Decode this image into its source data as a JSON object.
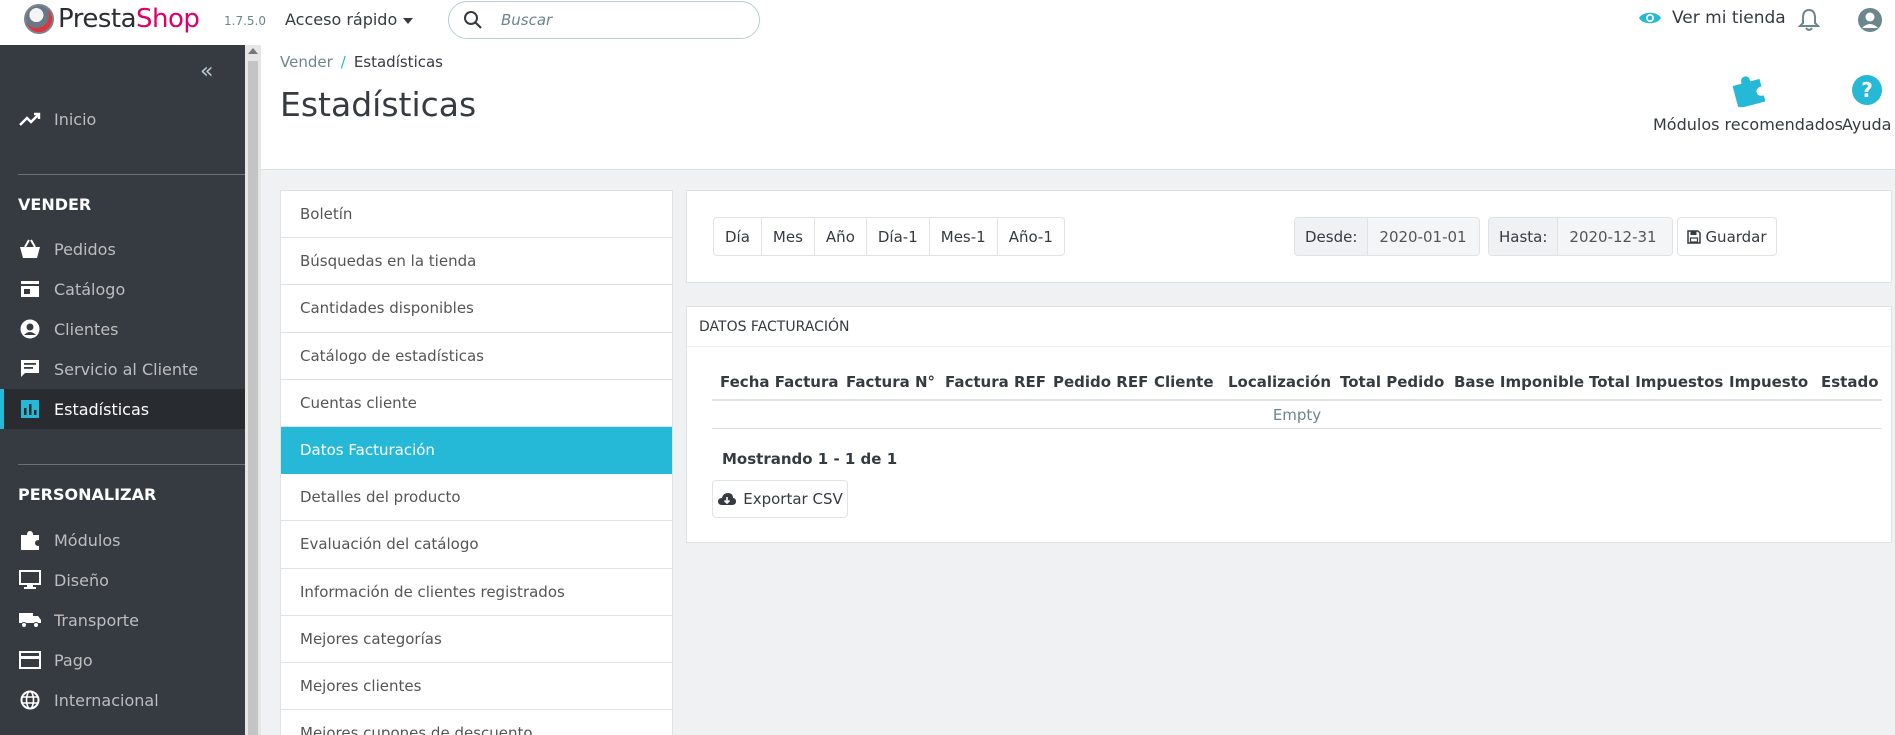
{
  "header": {
    "brand_presta": "Presta",
    "brand_shop": "Shop",
    "version": "1.7.5.0",
    "quick_access": "Acceso rápido",
    "search_placeholder": "Buscar",
    "view_store": "Ver mi tienda"
  },
  "sidebar": {
    "home": "Inicio",
    "section_sell": "VENDER",
    "sell_items": [
      "Pedidos",
      "Catálogo",
      "Clientes",
      "Servicio al Cliente",
      "Estadísticas"
    ],
    "section_customize": "PERSONALIZAR",
    "customize_items": [
      "Módulos",
      "Diseño",
      "Transporte",
      "Pago",
      "Internacional"
    ]
  },
  "breadcrumb": {
    "parent": "Vender",
    "separator": "/",
    "current": "Estadísticas"
  },
  "page_title": "Estadísticas",
  "toolbar": {
    "modules": "Módulos recomendados",
    "help": "Ayuda"
  },
  "stats_list": [
    "Boletín",
    "Búsquedas en la tienda",
    "Cantidades disponibles",
    "Catálogo de estadísticas",
    "Cuentas cliente",
    "Datos Facturación",
    "Detalles del producto",
    "Evaluación del catálogo",
    "Información de clientes registrados",
    "Mejores categorías",
    "Mejores clientes",
    "Mejores cupones de descuento"
  ],
  "stats_list_active_index": 5,
  "date_panel": {
    "period_buttons": [
      "Día",
      "Mes",
      "Año",
      "Día-1",
      "Mes-1",
      "Año-1"
    ],
    "from_label": "Desde:",
    "from_value": "2020-01-01",
    "to_label": "Hasta:",
    "to_value": "2020-12-31",
    "save_label": "Guardar"
  },
  "data_panel": {
    "heading": "DATOS FACTURACIÓN",
    "columns": [
      "Fecha Factura",
      "Factura N°",
      "Factura REF",
      "Pedido REF",
      "Cliente",
      "Localización",
      "Total Pedido",
      "Base Imponible",
      "Total Impuestos",
      "Impuesto",
      "Estado"
    ],
    "empty_text": "Empty",
    "showing_text": "Mostrando 1 - 1 de 1",
    "export_label": "Exportar CSV"
  },
  "colors": {
    "accent": "#25b9d7",
    "sidebar": "#363a41",
    "brand_pink": "#df0067"
  }
}
